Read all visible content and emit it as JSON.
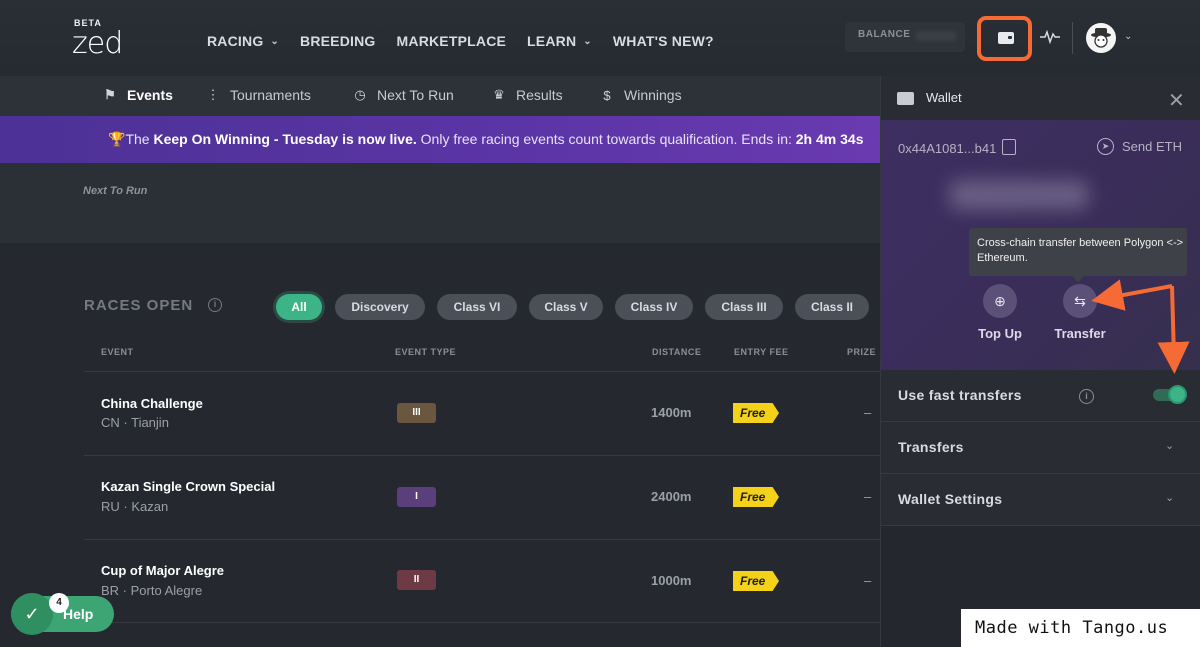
{
  "header": {
    "logo_beta": "BETA",
    "logo_mark": "zed",
    "nav": [
      {
        "label": "RACING",
        "has_dropdown": true
      },
      {
        "label": "BREEDING",
        "has_dropdown": false
      },
      {
        "label": "MARKETPLACE",
        "has_dropdown": false
      },
      {
        "label": "LEARN",
        "has_dropdown": true
      },
      {
        "label": "WHAT'S NEW?",
        "has_dropdown": false
      }
    ],
    "balance_label": "BALANCE",
    "icons": [
      "wallet-icon",
      "activity-icon",
      "avatar",
      "chevron-down-icon"
    ]
  },
  "subnav": {
    "tabs": [
      {
        "label": "Events",
        "icon": "flag-icon",
        "active": true
      },
      {
        "label": "Tournaments",
        "icon": "bracket-icon",
        "active": false
      },
      {
        "label": "Next To Run",
        "icon": "clock-icon",
        "active": false
      },
      {
        "label": "Results",
        "icon": "trophy-icon",
        "active": false
      },
      {
        "label": "Winnings",
        "icon": "dollar-icon",
        "active": false
      }
    ]
  },
  "banner": {
    "prefix": "The ",
    "highlight": "Keep On Winning - Tuesday is now live.",
    "rest": " Only free racing events count towards qualification. Ends in: ",
    "countdown": "2h 4m 34s"
  },
  "next_to_run": {
    "label": "Next To Run"
  },
  "races": {
    "title": "RACES OPEN",
    "filters": [
      "All",
      "Discovery",
      "Class VI",
      "Class V",
      "Class IV",
      "Class III",
      "Class II"
    ],
    "active_filter": "All",
    "columns": [
      "EVENT",
      "EVENT TYPE",
      "DISTANCE",
      "ENTRY FEE",
      "PRIZE"
    ],
    "rows": [
      {
        "name": "China Challenge",
        "country": "CN",
        "city": "Tianjin",
        "class": "III",
        "class_color": "#6b5640",
        "distance": "1400m",
        "fee": "Free",
        "prize": "–"
      },
      {
        "name": "Kazan Single Crown Special",
        "country": "RU",
        "city": "Kazan",
        "class": "I",
        "class_color": "#5a3f7a",
        "distance": "2400m",
        "fee": "Free",
        "prize": "–"
      },
      {
        "name": "Cup of Major Alegre",
        "country": "BR",
        "city": "Porto Alegre",
        "class": "II",
        "class_color": "#6e3a44",
        "distance": "1000m",
        "fee": "Free",
        "prize": "–"
      }
    ]
  },
  "wallet": {
    "title": "Wallet",
    "address": "0x44A1081...b41",
    "send_label": "Send ETH",
    "tooltip": "Cross-chain transfer between Polygon <-> Ethereum.",
    "actions": [
      {
        "label": "Top Up",
        "icon": "plus-circle-icon"
      },
      {
        "label": "Transfer",
        "icon": "transfer-arrows-icon"
      }
    ],
    "fast_transfers_label": "Use fast transfers",
    "fast_transfers_on": true,
    "sections": [
      "Transfers",
      "Wallet Settings"
    ]
  },
  "help": {
    "label": "Help",
    "badge": "4"
  },
  "watermark": "Made with Tango.us",
  "colors": {
    "accent": "#3cb488",
    "annotation": "#f56a35",
    "banner": "#5b35a6",
    "free": "#f5d21a"
  }
}
